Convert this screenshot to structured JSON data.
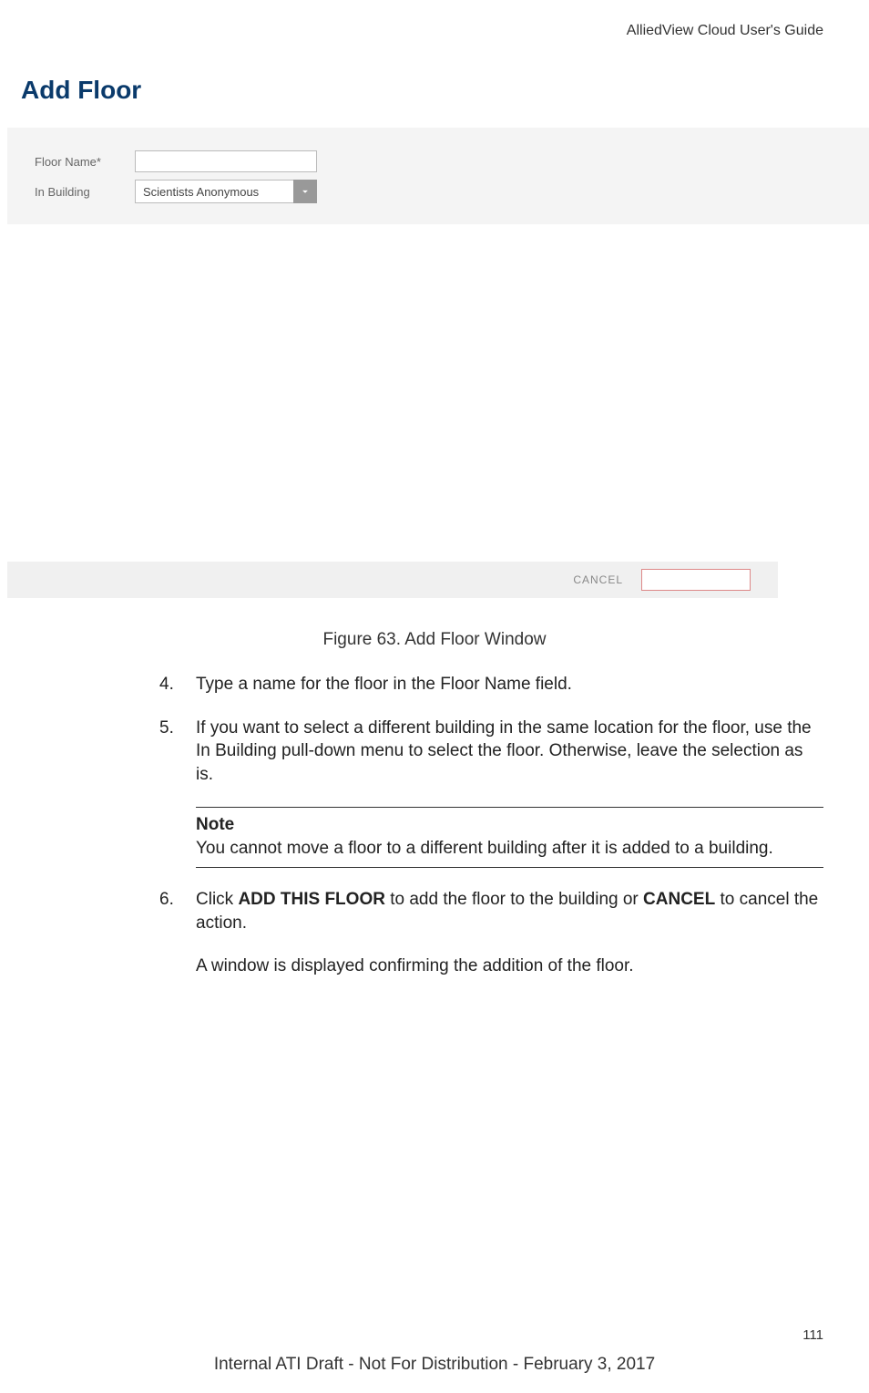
{
  "header": {
    "guide_title": "AlliedView Cloud User's Guide"
  },
  "screenshot": {
    "window_title": "Add Floor",
    "form": {
      "floor_name_label": "Floor Name*",
      "floor_name_value": "",
      "in_building_label": "In Building",
      "in_building_value": "Scientists Anonymous"
    },
    "buttons": {
      "cancel": "CANCEL",
      "add": ""
    }
  },
  "figure_caption": "Figure 63. Add Floor Window",
  "steps": {
    "step4_num": "4.",
    "step4_text": "Type a name for the floor in the Floor Name field.",
    "step5_num": "5.",
    "step5_text": "If you want to select a different building in the same location for the floor, use the In Building pull-down menu to select the floor. Otherwise, leave the selection as is.",
    "step6_num": "6.",
    "step6_pre": "Click ",
    "step6_bold1": "ADD THIS FLOOR",
    "step6_mid": " to add the floor to the building or ",
    "step6_bold2": "CANCEL",
    "step6_post": " to cancel the action.",
    "step6_followup": "A window is displayed confirming the addition of the floor."
  },
  "note": {
    "title": "Note",
    "text": "You cannot move a floor to a different building after it is added to a building."
  },
  "page_number": "111",
  "footer": "Internal ATI Draft - Not For Distribution - February 3, 2017"
}
